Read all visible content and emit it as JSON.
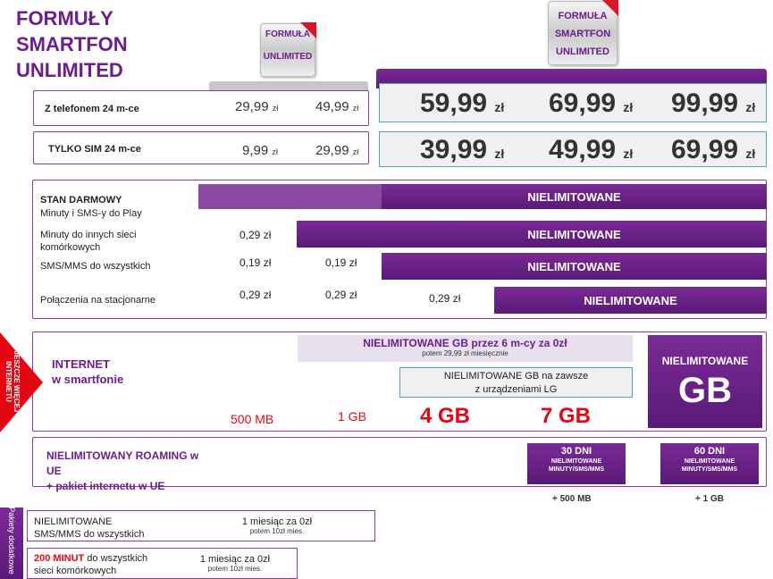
{
  "title": {
    "line1": "FORMUŁY",
    "line2": "SMARTFON",
    "line3": "UNLIMITED"
  },
  "badges": {
    "left": {
      "line1": "FORMUŁA",
      "line2": "UNLIMITED"
    },
    "right": {
      "line1": "FORMUŁA",
      "line2": "SMARTFON",
      "line3": "UNLIMITED"
    }
  },
  "rows": {
    "phone": {
      "label": "Z telefonem 24 m-ce",
      "prices": [
        "29,99",
        "49,99",
        "59,99",
        "69,99",
        "99,99"
      ],
      "currency": "zł"
    },
    "sim": {
      "label": "TYLKO SIM 24 m-ce",
      "prices": [
        "9,99",
        "29,99",
        "39,99",
        "49,99",
        "69,99"
      ],
      "currency": "zł"
    }
  },
  "calls": {
    "stan": {
      "title": "STAN DARMOWY",
      "sub": "Minuty i SMS-y do Play",
      "value": "NIELIMITOWANE"
    },
    "minutes": {
      "label": "Minuty do innych sieci komórkowych",
      "fee": "0,29 zł",
      "value": "NIELIMITOWANE"
    },
    "sms": {
      "label": "SMS/MMS do wszystkich",
      "fee1": "0,19 zł",
      "fee2": "0,19 zł",
      "value": "NIELIMITOWANE"
    },
    "landline": {
      "label": "Połączenia na stacjonarne",
      "fee1": "0,29 zł",
      "fee2": "0,29 zł",
      "fee3": "0,29 zł",
      "value": "NIELIMITOWANE"
    }
  },
  "internet": {
    "corner": "JESZCZE WIĘCEJ INTERNETU",
    "label_line1": "INTERNET",
    "label_line2": "w smartfonie",
    "promo_title": "NIELIMITOWANE GB przez 6 m-cy za 0zł",
    "promo_sub": "potem 29,99 zł miesięcznie",
    "lg_line1": "NIELIMITOWANE GB na zawsze",
    "lg_line2": "z urządzeniami LG",
    "values": [
      "500 MB",
      "1 GB",
      "4 GB",
      "7 GB"
    ],
    "unlimited_title": "NIELIMITOWANE",
    "unlimited_gb": "GB"
  },
  "roaming": {
    "label_line1": "NIELIMITOWANY ROAMING w",
    "label_line2": "UE",
    "label_line3": "+ pakiet internetu w UE",
    "p30_days": "30 DNI",
    "p30_sub1": "NIELIMITOWANE",
    "p30_sub2": "MINUTY/SMS/MMS",
    "p30_extra": "+ 500 MB",
    "p60_days": "60 DNI",
    "p60_sub1": "NIELIMITOWANE",
    "p60_sub2": "MINUTY/SMS/MMS",
    "p60_extra": "+ 1 GB"
  },
  "packages": {
    "side_label": "Pakiety dodatkowe",
    "p1_line1": "NIELIMITOWANE",
    "p1_line2": "SMS/MMS do wszystkich",
    "p1_offer": "1 miesiąc za 0zł",
    "p1_after": "potem 10zł mies.",
    "p2_red": "200 MINUT",
    "p2_line1": " do wszystkich",
    "p2_line2": "sieci komórkowych",
    "p2_offer": "1 miesiąc za 0zł",
    "p2_after": "potem 10zł mies."
  },
  "colors": {
    "purple": "#6b1e8c",
    "red": "#e30613",
    "light_lilac": "#e8e0ee"
  }
}
